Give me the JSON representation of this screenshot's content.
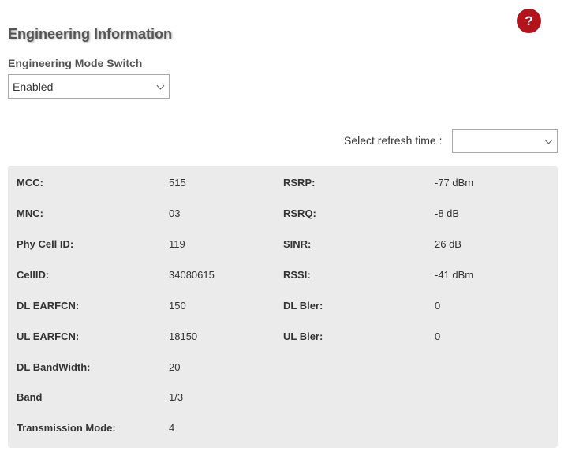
{
  "help": {
    "label": "?"
  },
  "title": "Engineering Information",
  "mode_switch": {
    "label": "Engineering Mode Switch",
    "value": "Enabled"
  },
  "refresh": {
    "label": "Select refresh time :",
    "value": ""
  },
  "info": {
    "left": [
      {
        "label": "MCC:",
        "value": "515"
      },
      {
        "label": "MNC:",
        "value": "03"
      },
      {
        "label": "Phy Cell ID:",
        "value": "119"
      },
      {
        "label": "CellID:",
        "value": "34080615"
      },
      {
        "label": "DL EARFCN:",
        "value": "150"
      },
      {
        "label": "UL EARFCN:",
        "value": "18150"
      },
      {
        "label": "DL BandWidth:",
        "value": "20"
      },
      {
        "label": "Band",
        "value": "1/3"
      },
      {
        "label": "Transmission Mode:",
        "value": "4"
      }
    ],
    "right": [
      {
        "label": "RSRP:",
        "value": "-77 dBm"
      },
      {
        "label": "RSRQ:",
        "value": "-8 dB"
      },
      {
        "label": "SINR:",
        "value": "26 dB"
      },
      {
        "label": "RSSI:",
        "value": "-41 dBm"
      },
      {
        "label": "DL Bler:",
        "value": "0"
      },
      {
        "label": "UL Bler:",
        "value": "0"
      }
    ]
  },
  "colors": {
    "accent": "#b3141b",
    "panel_bg": "#ebebeb"
  }
}
